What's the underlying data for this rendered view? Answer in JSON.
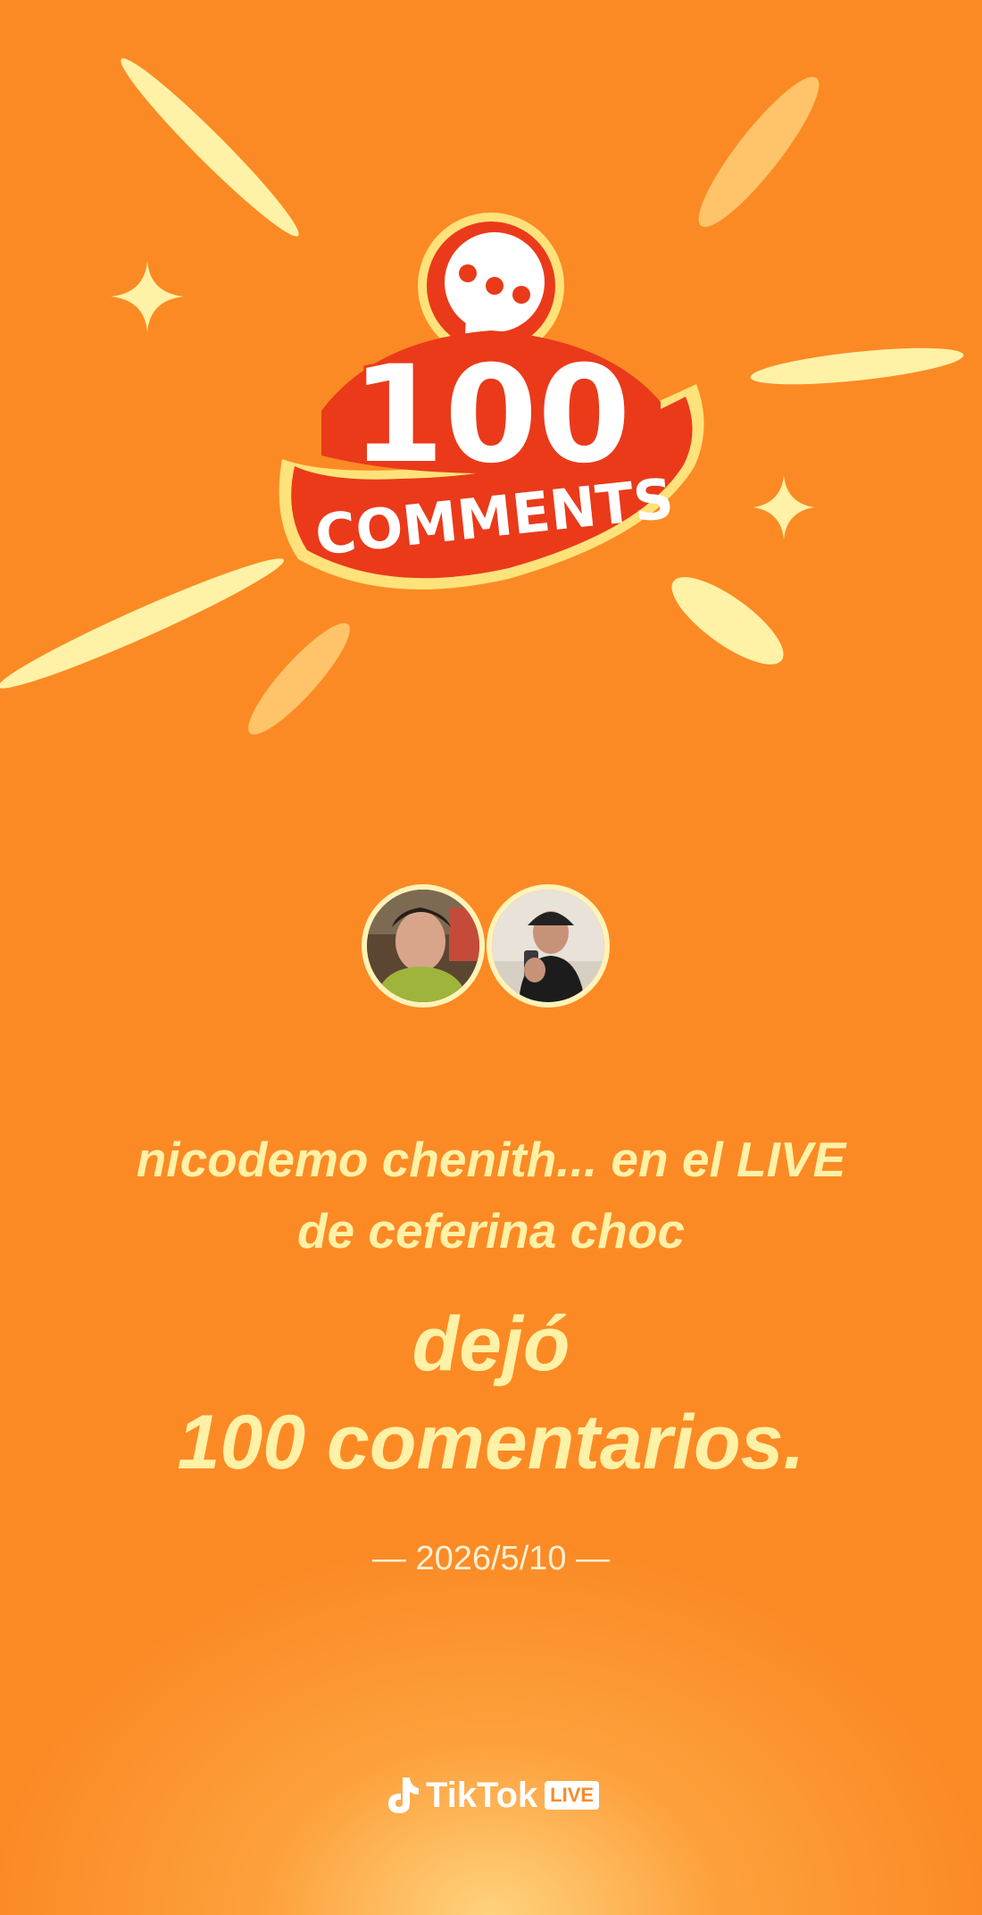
{
  "badge": {
    "number": "100",
    "word": "COMMENTS",
    "icon": "speech-bubble-icon"
  },
  "users": [
    {
      "avatar": "avatar-photo-woman"
    },
    {
      "avatar": "avatar-photo-man-cap"
    }
  ],
  "message": {
    "line1": "nicodemo chenith... en el LIVE",
    "line2": "de ceferina choc",
    "action1": "dejó",
    "action2": "100 comentarios."
  },
  "date": "— 2026/5/10 —",
  "brand": {
    "name": "TikTok",
    "badge": "LIVE",
    "icon": "tiktok-note-icon"
  },
  "colors": {
    "background": "#fb8a25",
    "text": "#fff1a6",
    "badge_red": "#ea3a1a",
    "badge_border": "#ffe27a"
  }
}
